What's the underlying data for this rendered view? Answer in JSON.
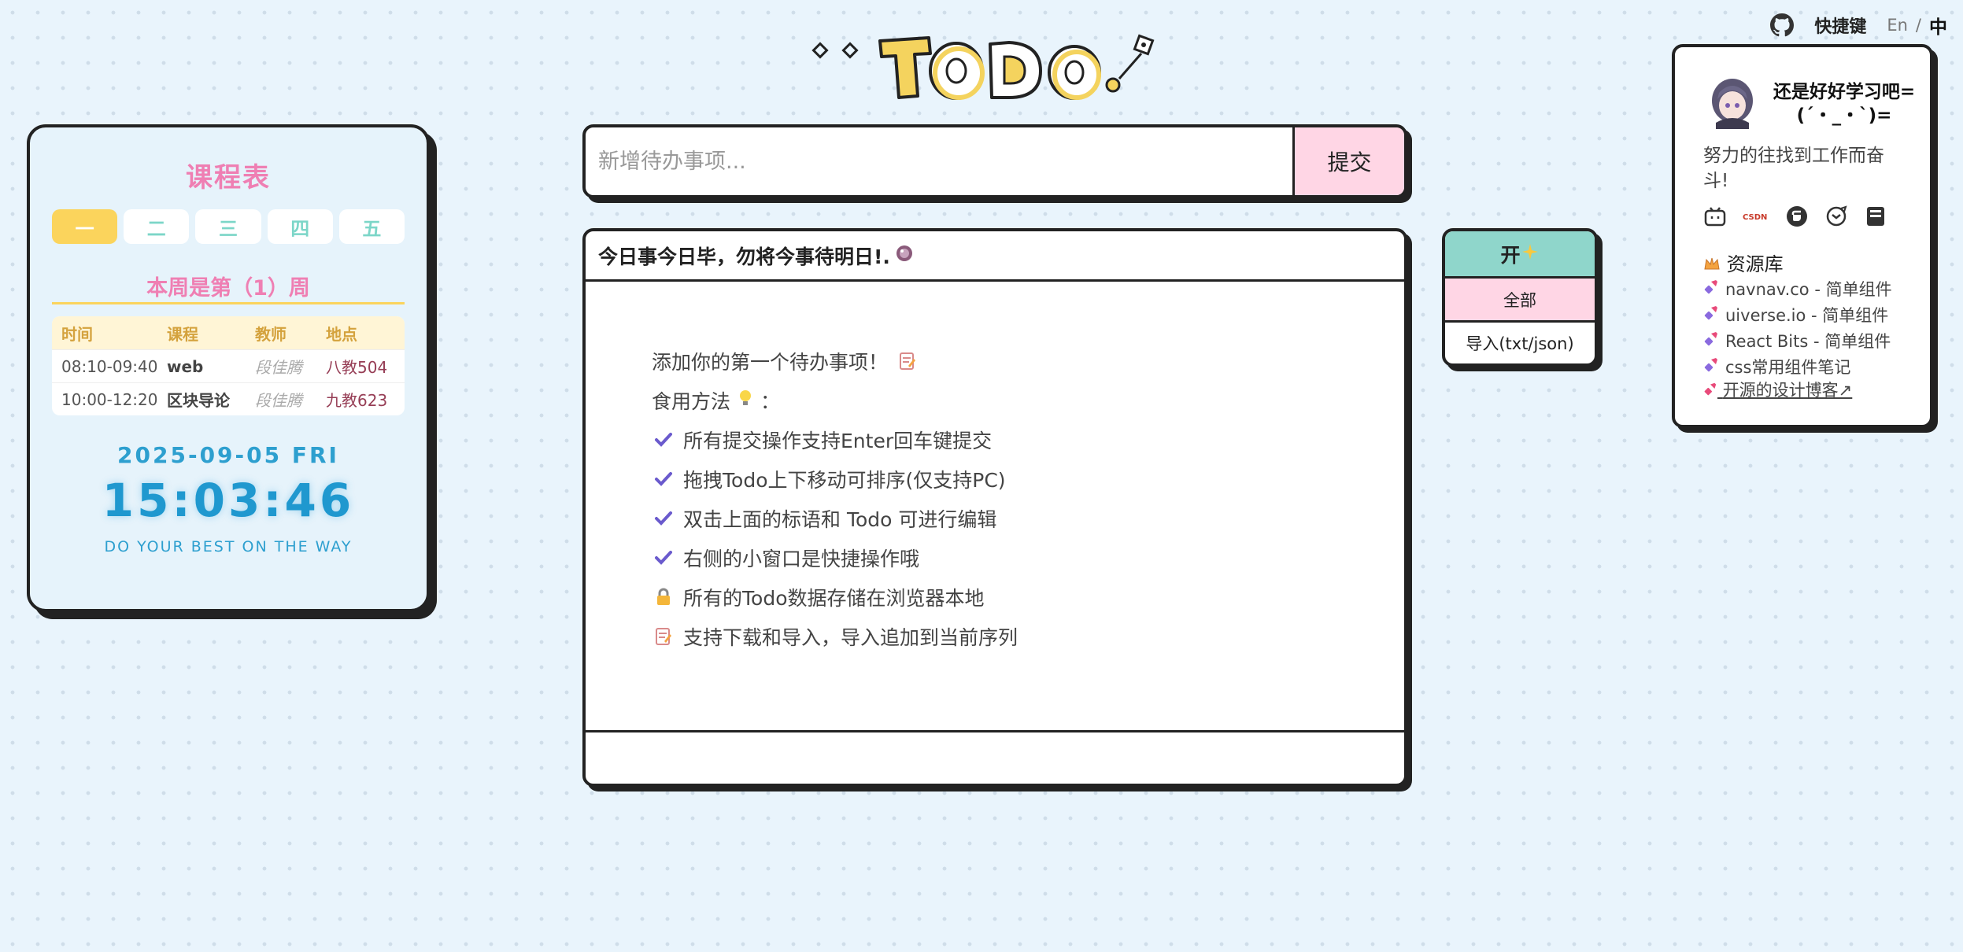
{
  "topbar": {
    "shortcut_label": "快捷键",
    "lang_en": "En",
    "lang_sep": "/",
    "lang_zh": "中"
  },
  "logo": {
    "text": "TODO",
    "colors": {
      "yellow": "#f4d35e",
      "outline": "#222222",
      "diamond": "#222222"
    }
  },
  "course": {
    "title": "课程表",
    "days": [
      "一",
      "二",
      "三",
      "四",
      "五"
    ],
    "active_day": 0,
    "week_label": "本周是第（1）周",
    "columns": [
      "时间",
      "课程",
      "教师",
      "地点"
    ],
    "rows": [
      {
        "time": "08:10-09:40",
        "course": "web",
        "teacher": "段佳腾",
        "room": "八教504"
      },
      {
        "time": "10:00-12:20",
        "course": "区块导论",
        "teacher": "段佳腾",
        "room": "九教623"
      }
    ],
    "date": "2025-09-05 FRI",
    "clock": "15:03:46",
    "motto": "DO YOUR BEST ON THE WAY"
  },
  "input": {
    "placeholder": "新增待办事项...",
    "value": "",
    "submit_label": "提交"
  },
  "todo": {
    "header_title": "今日事今日毕，勿将今事待明日!.",
    "intro_first": "添加你的第一个待办事项！",
    "usage_label": "食用方法",
    "usage_suffix": "：",
    "tips": [
      {
        "icon": "check-icon",
        "text": "所有提交操作支持Enter回车键提交"
      },
      {
        "icon": "check-icon",
        "text": "拖拽Todo上下移动可排序(仅支持PC)"
      },
      {
        "icon": "check-icon",
        "text": "双击上面的标语和 Todo 可进行编辑"
      },
      {
        "icon": "check-icon",
        "text": "右侧的小窗口是快捷操作哦"
      },
      {
        "icon": "lock-icon",
        "text": "所有的Todo数据存储在浏览器本地"
      },
      {
        "icon": "memo-icon",
        "text": "支持下载和导入，导入追加到当前序列"
      }
    ]
  },
  "mini": {
    "toggle_label": "开",
    "all_label": "全部",
    "import_label": "导入(txt/json)"
  },
  "profile": {
    "name": "还是好好学习吧=(´・_・`)=",
    "description": "努力的往找到工作而奋斗!",
    "socials": [
      "bilibili-icon",
      "csdn-icon",
      "gitee-icon",
      "juejin-icon",
      "notes-icon"
    ],
    "csdn_text": "CSDN",
    "resources_title": "资源库",
    "resources": [
      "navnav.co - 简单组件",
      "uiverse.io - 简单组件",
      "React Bits - 简单组件",
      "css常用组件笔记"
    ],
    "blog_link": "开源的设计博客↗"
  },
  "colors": {
    "pink": "#ef7fb3",
    "yellow": "#fbd45c",
    "teal": "#8fd6cb",
    "blue": "#1f98cf",
    "light_pink": "#ffd6e5"
  }
}
